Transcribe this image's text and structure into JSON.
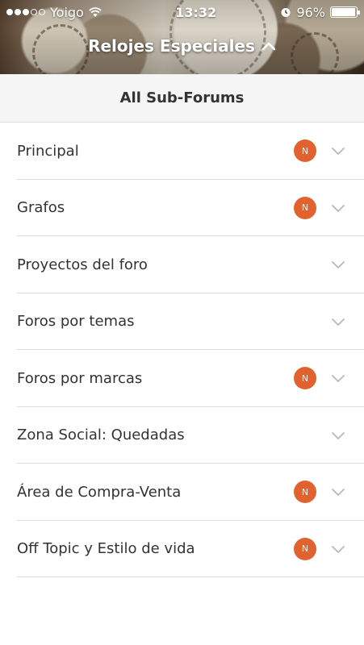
{
  "status_bar": {
    "carrier": "Yoigo",
    "time": "13:32",
    "battery": "96%",
    "battery_level": 0.96
  },
  "header": {
    "title": "Relojes Especiales",
    "icon": "chevron-up-icon"
  },
  "subforums_bar": {
    "label": "All Sub-Forums"
  },
  "forums": [
    {
      "label": "Principal",
      "badge": "N"
    },
    {
      "label": "Grafos",
      "badge": "N"
    },
    {
      "label": "Proyectos del foro",
      "badge": ""
    },
    {
      "label": "Foros por temas",
      "badge": ""
    },
    {
      "label": "Foros por marcas",
      "badge": "N"
    },
    {
      "label": "Zona Social: Quedadas",
      "badge": ""
    },
    {
      "label": "Área de Compra-Venta",
      "badge": "N"
    },
    {
      "label": "Off Topic y Estilo de vida",
      "badge": "N"
    }
  ],
  "colors": {
    "badge": "#e2622f",
    "chevron": "#b8b8b8"
  }
}
